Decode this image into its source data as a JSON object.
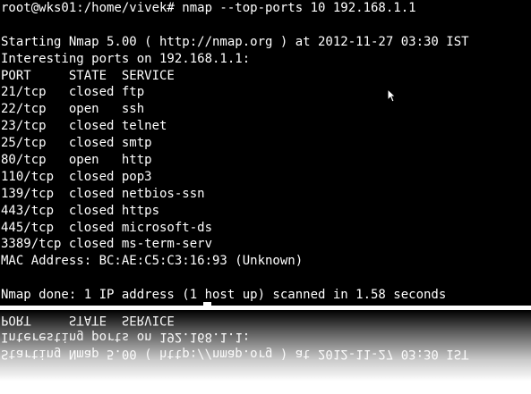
{
  "terminal": {
    "prompt_line": "root@wks01:/home/vivek# nmap --top-ports 10 192.168.1.1",
    "blank": "",
    "starting": "Starting Nmap 5.00 ( http://nmap.org ) at 2012-11-27 03:30 IST",
    "interesting": "Interesting ports on 192.168.1.1:",
    "header": "PORT     STATE  SERVICE",
    "ports": [
      "21/tcp   closed ftp",
      "22/tcp   open   ssh",
      "23/tcp   closed telnet",
      "25/tcp   closed smtp",
      "80/tcp   open   http",
      "110/tcp  closed pop3",
      "139/tcp  closed netbios-ssn",
      "443/tcp  closed https",
      "445/tcp  closed microsoft-ds",
      "3389/tcp closed ms-term-serv"
    ],
    "mac": "MAC Address: BC:AE:C5:C3:16:93 (Unknown)",
    "done": "Nmap done: 1 IP address (1 host up) scanned in 1.58 seconds"
  },
  "colors": {
    "background": "#000000",
    "text": "#ffffff"
  }
}
